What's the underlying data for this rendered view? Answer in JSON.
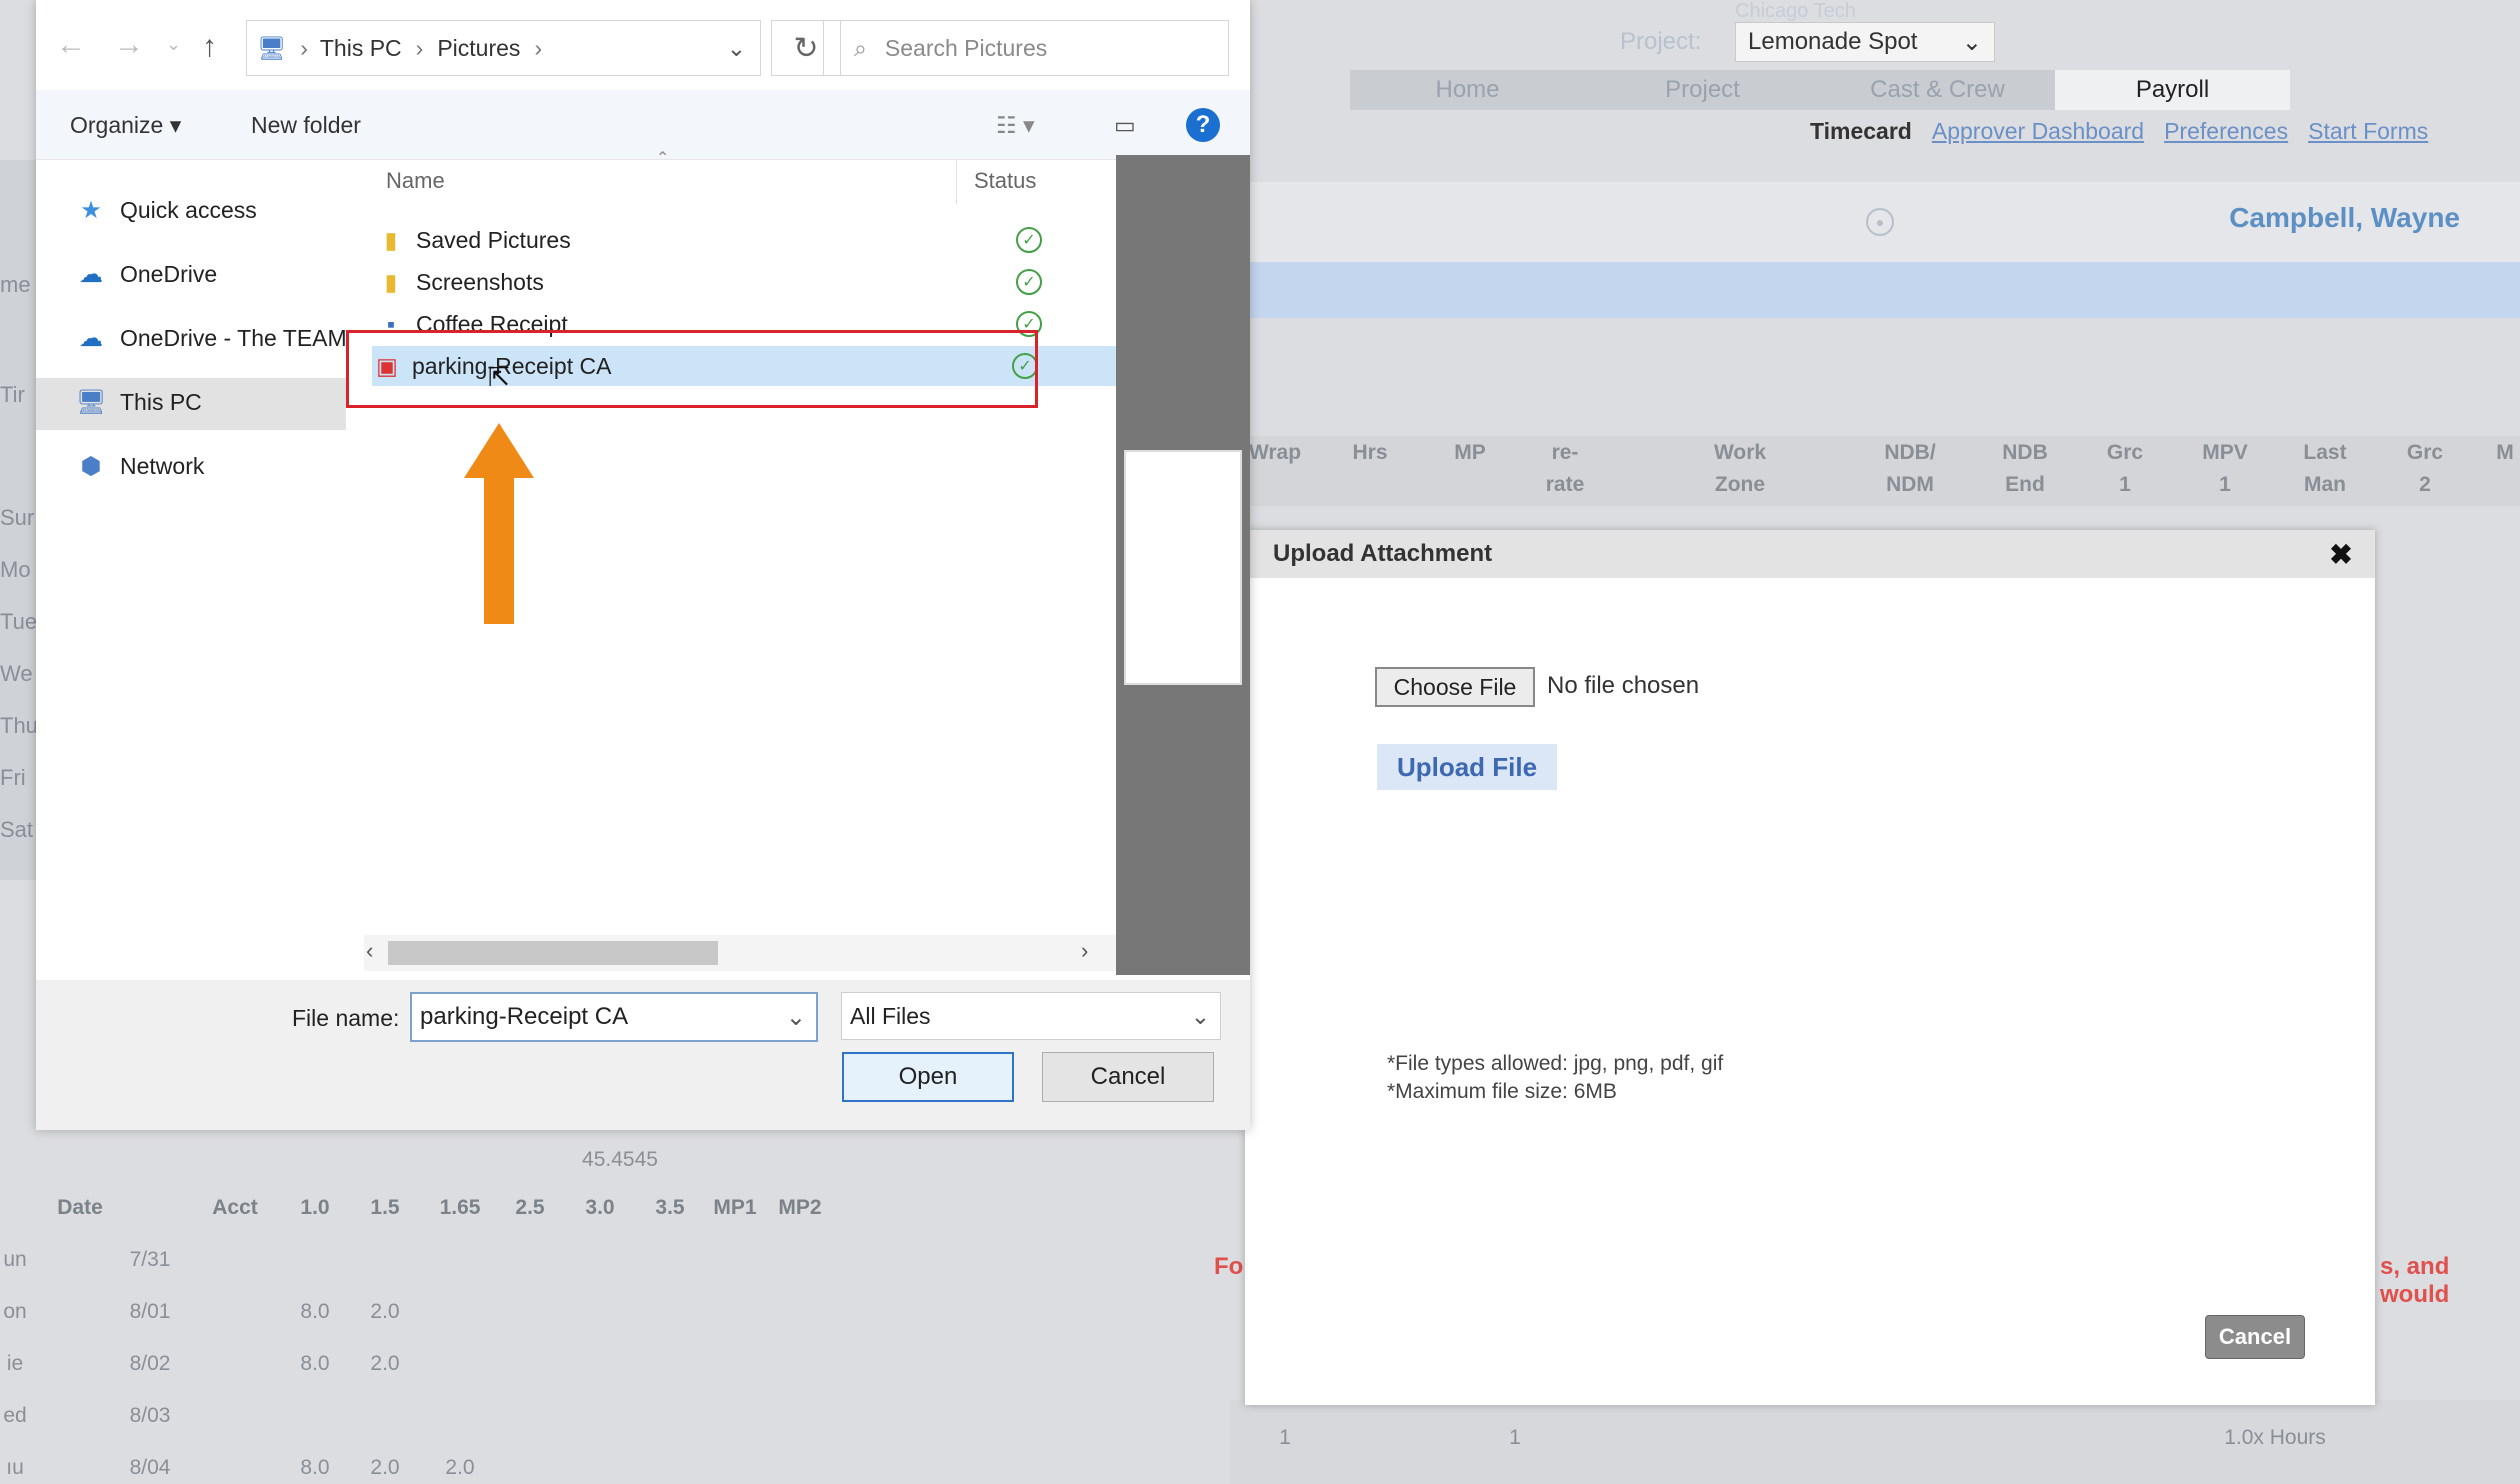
{
  "background_app": {
    "project_header": "Chicago Tech",
    "project_label": "Project:",
    "project_value": "Lemonade Spot",
    "nav_tabs": [
      "Home",
      "Project",
      "Cast & Crew",
      "Payroll"
    ],
    "subnav_current": "Timecard",
    "subnav_links": [
      "Approver Dashboard",
      "Preferences",
      "Start Forms"
    ],
    "employee_name": "Campbell, Wayne",
    "grid_headers": [
      {
        "top": "",
        "bottom": "Wrap"
      },
      {
        "top": "",
        "bottom": "Hrs"
      },
      {
        "top": "",
        "bottom": "MP"
      },
      {
        "top": "re-",
        "bottom": "rate"
      },
      {
        "top": "Work",
        "bottom": "Zone"
      },
      {
        "top": "NDB/",
        "bottom": "NDM"
      },
      {
        "top": "NDB",
        "bottom": "End"
      },
      {
        "top": "Grc",
        "bottom": "1"
      },
      {
        "top": "MPV",
        "bottom": "1"
      },
      {
        "top": "Last",
        "bottom": "Man"
      },
      {
        "top": "Grc",
        "bottom": "2"
      },
      {
        "top": "M",
        "bottom": ""
      }
    ],
    "left_days": [
      "Sur",
      "Mo",
      "Tue",
      "We",
      "Thu",
      "Fri",
      "Sat"
    ],
    "left_fragments": [
      "me",
      "Tir"
    ],
    "bottom_total": "45.4545",
    "bottom_columns": [
      "Date",
      "Acct",
      "1.0",
      "1.5",
      "1.65",
      "2.5",
      "3.0",
      "3.5",
      "MP1",
      "MP2"
    ],
    "bottom_rows": [
      {
        "day": "un",
        "date": "7/31",
        "c10": "",
        "c15": "",
        "c165": ""
      },
      {
        "day": "on",
        "date": "8/01",
        "c10": "8.0",
        "c15": "2.0",
        "c165": ""
      },
      {
        "day": "ie",
        "date": "8/02",
        "c10": "8.0",
        "c15": "2.0",
        "c165": ""
      },
      {
        "day": "ed",
        "date": "8/03",
        "c10": "",
        "c15": "",
        "c165": ""
      },
      {
        "day": "ıu",
        "date": "8/04",
        "c10": "8.0",
        "c15": "2.0",
        "c165": "2.0"
      }
    ],
    "red_fragment_left": "Fo",
    "red_fragment_right": "s, and would",
    "lower_row": {
      "a": "1",
      "b": "1",
      "c": "1.0x Hours"
    }
  },
  "upload_dialog": {
    "title": "Upload Attachment",
    "close_glyph": "✖",
    "choose_file_label": "Choose File",
    "no_file_text": "No file chosen",
    "upload_button_label": "Upload File",
    "note_types": "*File types allowed: jpg, png, pdf, gif",
    "note_size": "*Maximum file size: 6MB",
    "cancel_label": "Cancel"
  },
  "file_dialog": {
    "breadcrumb": [
      "This PC",
      "Pictures"
    ],
    "search_placeholder": "Search Pictures",
    "toolbar": {
      "organize": "Organize ▾",
      "new_folder": "New folder"
    },
    "sidebar": [
      {
        "label": "Quick access",
        "icon": "star-icon"
      },
      {
        "label": "OneDrive",
        "icon": "cloud-icon"
      },
      {
        "label": "OneDrive - The TEAM",
        "icon": "cloud-icon"
      },
      {
        "label": "This PC",
        "icon": "computer-icon",
        "active": true
      },
      {
        "label": "Network",
        "icon": "network-icon"
      }
    ],
    "columns": {
      "name": "Name",
      "status": "Status"
    },
    "files": [
      {
        "name": "Saved Pictures",
        "type": "folder",
        "status": "synced"
      },
      {
        "name": "Screenshots",
        "type": "folder",
        "status": "synced"
      },
      {
        "name": "Coffee Receipt",
        "type": "image",
        "status": "synced"
      },
      {
        "name": "parking-Receipt CA",
        "type": "image",
        "status": "synced",
        "selected": true
      }
    ],
    "file_name_label": "File name:",
    "file_name_value": "parking-Receipt CA",
    "file_type_value": "All Files",
    "open_label": "Open",
    "cancel_label": "Cancel"
  },
  "colors": {
    "highlight_box": "#d8232a",
    "arrow": "#f08a16",
    "accent": "#2f74c9"
  }
}
